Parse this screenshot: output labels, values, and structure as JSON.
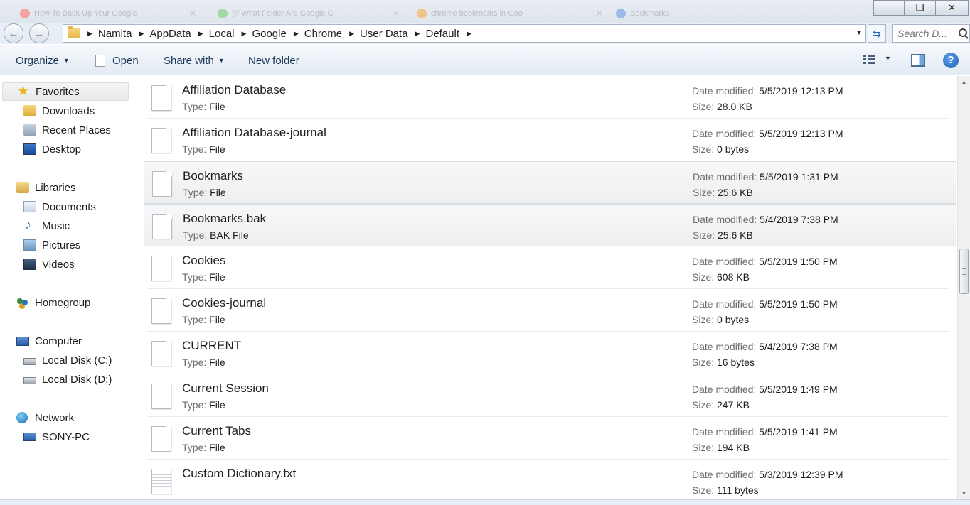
{
  "browser_tabs": [
    {
      "title": "How To Back Up Your Google",
      "color": "#f2a3a3"
    },
    {
      "title": "(r/ What Folder Are Google C",
      "color": "#a6d8a6"
    },
    {
      "title": "chrome bookmarks in Goo",
      "color": "#f2c38a"
    },
    {
      "title": "Bookmarks",
      "color": "#9cbbea"
    }
  ],
  "window_controls": {
    "minimize": "—",
    "maximize": "❏",
    "close": "✕"
  },
  "address": {
    "breadcrumbs": [
      "Namita",
      "AppData",
      "Local",
      "Google",
      "Chrome",
      "User Data",
      "Default"
    ],
    "search_placeholder": "Search D..."
  },
  "toolbar": {
    "organize": "Organize",
    "open": "Open",
    "share_with": "Share with",
    "new_folder": "New folder"
  },
  "nav": {
    "favorites": {
      "label": "Favorites",
      "icon": "star-icon",
      "items": [
        {
          "label": "Downloads",
          "icon": "downloads-folder-icon"
        },
        {
          "label": "Recent Places",
          "icon": "recent-places-icon"
        },
        {
          "label": "Desktop",
          "icon": "desktop-icon"
        }
      ]
    },
    "libraries": {
      "label": "Libraries",
      "icon": "libraries-icon",
      "items": [
        {
          "label": "Documents",
          "icon": "documents-icon"
        },
        {
          "label": "Music",
          "icon": "music-icon"
        },
        {
          "label": "Pictures",
          "icon": "pictures-icon"
        },
        {
          "label": "Videos",
          "icon": "videos-icon"
        }
      ]
    },
    "homegroup": {
      "label": "Homegroup",
      "icon": "homegroup-icon"
    },
    "computer": {
      "label": "Computer",
      "icon": "computer-icon",
      "items": [
        {
          "label": "Local Disk (C:)",
          "icon": "disk-icon"
        },
        {
          "label": "Local Disk (D:)",
          "icon": "disk-icon"
        }
      ]
    },
    "network": {
      "label": "Network",
      "icon": "network-icon",
      "items": [
        {
          "label": "SONY-PC",
          "icon": "pc-icon"
        }
      ]
    }
  },
  "labels": {
    "type": "Type:",
    "date_modified": "Date modified:",
    "size": "Size:"
  },
  "files": [
    {
      "name": "Affiliation Database",
      "type": "File",
      "date": "5/5/2019 12:13 PM",
      "size": "28.0 KB",
      "icon": "file-icon"
    },
    {
      "name": "Affiliation Database-journal",
      "type": "File",
      "date": "5/5/2019 12:13 PM",
      "size": "0 bytes",
      "icon": "file-icon"
    },
    {
      "name": "Bookmarks",
      "type": "File",
      "date": "5/5/2019 1:31 PM",
      "size": "25.6 KB",
      "icon": "file-icon",
      "highlighted": true
    },
    {
      "name": "Bookmarks.bak",
      "type": "BAK File",
      "date": "5/4/2019 7:38 PM",
      "size": "25.6 KB",
      "icon": "file-icon",
      "highlighted": true
    },
    {
      "name": "Cookies",
      "type": "File",
      "date": "5/5/2019 1:50 PM",
      "size": "608 KB",
      "icon": "file-icon"
    },
    {
      "name": "Cookies-journal",
      "type": "File",
      "date": "5/5/2019 1:50 PM",
      "size": "0 bytes",
      "icon": "file-icon"
    },
    {
      "name": "CURRENT",
      "type": "File",
      "date": "5/4/2019 7:38 PM",
      "size": "16 bytes",
      "icon": "file-icon"
    },
    {
      "name": "Current Session",
      "type": "File",
      "date": "5/5/2019 1:49 PM",
      "size": "247 KB",
      "icon": "file-icon"
    },
    {
      "name": "Current Tabs",
      "type": "File",
      "date": "5/5/2019 1:41 PM",
      "size": "194 KB",
      "icon": "file-icon"
    },
    {
      "name": "Custom Dictionary.txt",
      "type": "",
      "date": "5/3/2019 12:39 PM",
      "size": "111 bytes",
      "icon": "text-file-icon"
    }
  ]
}
